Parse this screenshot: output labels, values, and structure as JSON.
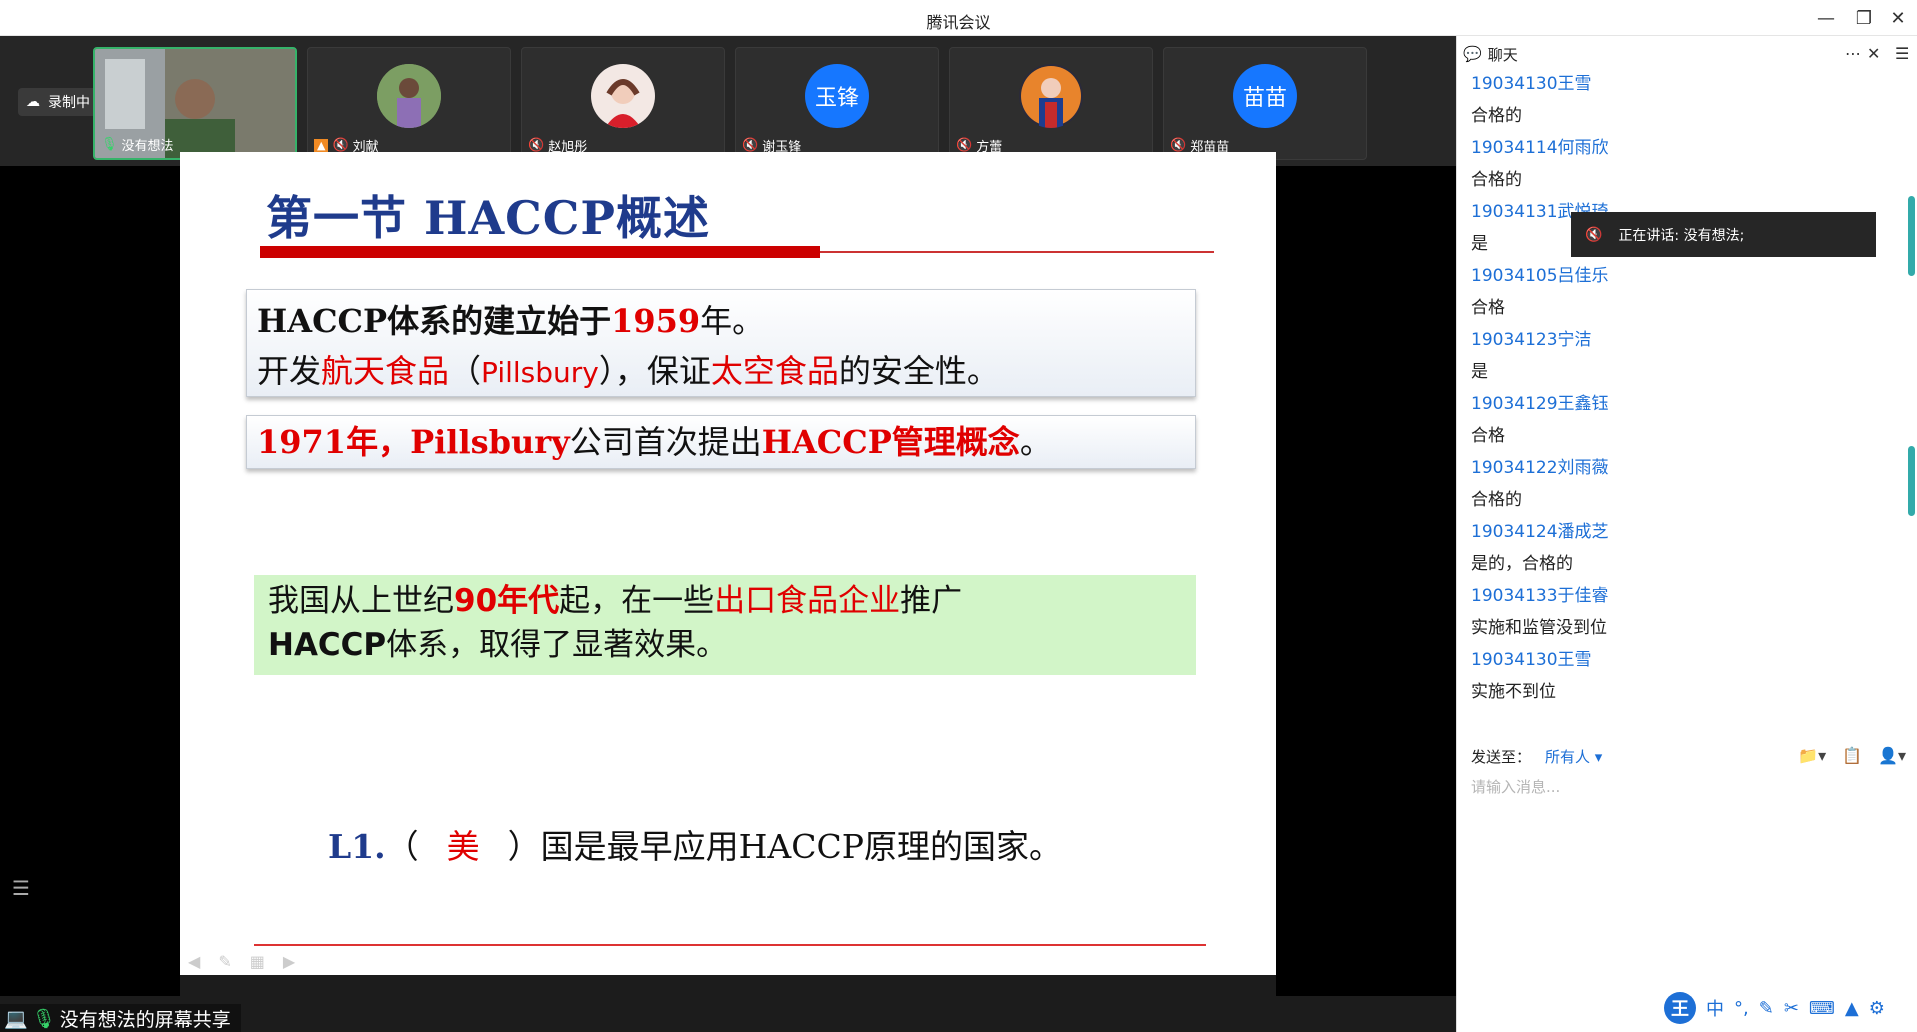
{
  "window": {
    "title": "腾讯会议"
  },
  "recording": {
    "label": "录制中"
  },
  "participants": [
    {
      "name": "没有想法",
      "avatar": ""
    },
    {
      "name": "刘献",
      "avatar": ""
    },
    {
      "name": "赵旭彤",
      "avatar": ""
    },
    {
      "name": "谢玉锋",
      "avatar": "玉锋"
    },
    {
      "name": "方蕾",
      "avatar": ""
    },
    {
      "name": "郑苗苗",
      "avatar": "苗苗"
    }
  ],
  "slide": {
    "title": "第一节 HACCP概述",
    "box1": {
      "line1_a": "HACCP体系的建立始于",
      "line1_year": "1959",
      "line1_b": "年。",
      "line2_a": "开发",
      "line2_red1": "航天食品",
      "line2_b": "（",
      "line2_pill": "Pillsbury",
      "line2_c": "），保证",
      "line2_red2": "太空食品",
      "line2_d": "的安全性。"
    },
    "box2": {
      "red1": "1971年，",
      "red2": "Pillsbury",
      "mid": "公司首次提出",
      "red3": "HACCP管理概念",
      "end": "。"
    },
    "box3": {
      "a": "我国从上世纪",
      "red1": "90年代",
      "b": "起，在一些",
      "red2": "出口食品企业",
      "c": "推广",
      "line2_bold": "HACCP",
      "line2_rest": "体系，取得了显著效果。"
    },
    "question": {
      "label": "L1.",
      "open": "（",
      "answer": "美",
      "close": "）",
      "rest": "国是最早应用HACCP原理的国家。"
    }
  },
  "share_label": "没有想法的屏幕共享",
  "chat": {
    "title": "聊天",
    "messages": [
      {
        "kind": "sender",
        "text": "19034130王雪"
      },
      {
        "kind": "text",
        "text": "合格的"
      },
      {
        "kind": "sender",
        "text": "19034114何雨欣"
      },
      {
        "kind": "text",
        "text": "合格的"
      },
      {
        "kind": "sender",
        "text": "19034131武悦琦"
      },
      {
        "kind": "text",
        "text": "是"
      },
      {
        "kind": "sender",
        "text": "19034105吕佳乐"
      },
      {
        "kind": "text",
        "text": "合格"
      },
      {
        "kind": "sender",
        "text": "19034123宁洁"
      },
      {
        "kind": "text",
        "text": "是"
      },
      {
        "kind": "sender",
        "text": "19034129王鑫钰"
      },
      {
        "kind": "text",
        "text": "合格"
      },
      {
        "kind": "sender",
        "text": "19034122刘雨薇"
      },
      {
        "kind": "text",
        "text": "合格的"
      },
      {
        "kind": "sender",
        "text": "19034124潘成芝"
      },
      {
        "kind": "text",
        "text": "是的，合格的"
      },
      {
        "kind": "sender",
        "text": "19034133于佳睿"
      },
      {
        "kind": "text",
        "text": "实施和监管没到位"
      },
      {
        "kind": "sender",
        "text": "19034130王雪"
      },
      {
        "kind": "text",
        "text": "实施不到位"
      }
    ],
    "send_to_label": "发送至：",
    "send_to_value": "所有人",
    "input_placeholder": "请输入消息..."
  },
  "speaking": {
    "label": "正在讲话: 没有想法;"
  },
  "ime": {
    "logo": "王",
    "mode": "中"
  }
}
